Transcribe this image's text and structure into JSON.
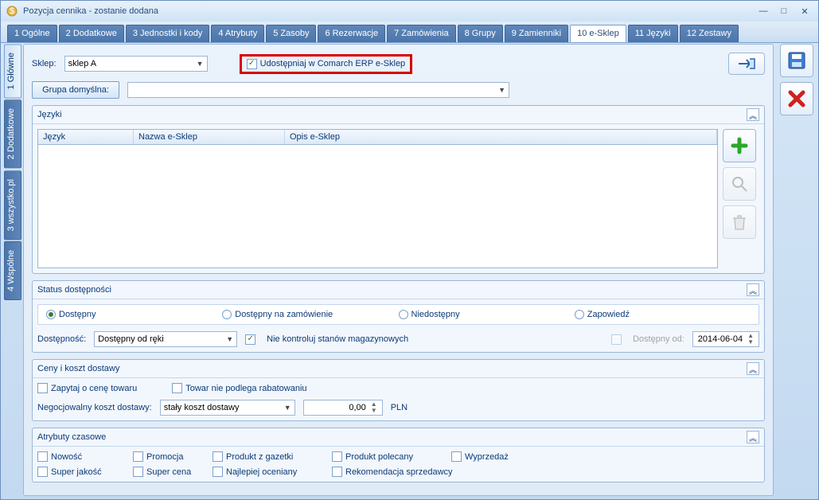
{
  "window": {
    "title": "Pozycja cennika - zostanie dodana"
  },
  "tabs": [
    {
      "label": "1 Ogólne"
    },
    {
      "label": "2 Dodatkowe"
    },
    {
      "label": "3 Jednostki i kody"
    },
    {
      "label": "4 Atrybuty"
    },
    {
      "label": "5 Zasoby"
    },
    {
      "label": "6 Rezerwacje"
    },
    {
      "label": "7 Zamówienia"
    },
    {
      "label": "8 Grupy"
    },
    {
      "label": "9 Zamienniki"
    },
    {
      "label": "10 e-Sklep"
    },
    {
      "label": "11 Języki"
    },
    {
      "label": "12 Zestawy"
    }
  ],
  "vtabs": [
    {
      "label": "1 Główne"
    },
    {
      "label": "2 Dodatkowe"
    },
    {
      "label": "3 wszystko.pl"
    },
    {
      "label": "4 Wspólne"
    }
  ],
  "shop_row": {
    "label": "Sklep:",
    "value": "sklep A",
    "share_label": "Udostępniaj w Comarch ERP e-Sklep"
  },
  "group_row": {
    "button": "Grupa domyślna:",
    "value": ""
  },
  "languages_panel": {
    "title": "Języki",
    "cols": [
      "Język",
      "Nazwa e-Sklep",
      "Opis e-Sklep"
    ]
  },
  "status_panel": {
    "title": "Status dostępności",
    "radios": [
      "Dostępny",
      "Dostępny na zamówienie",
      "Niedostępny",
      "Zapowiedź"
    ],
    "avail_label": "Dostępność:",
    "avail_value": "Dostępny od ręki",
    "nostock_label": "Nie kontroluj stanów magazynowych",
    "from_label": "Dostępny od:",
    "from_value": "2014-06-04"
  },
  "price_panel": {
    "title": "Ceny i koszt dostawy",
    "ask_price": "Zapytaj o cenę towaru",
    "no_discount": "Towar nie podlega rabatowaniu",
    "nego_label": "Negocjowalny koszt dostawy:",
    "nego_value": "stały koszt dostawy",
    "amount": "0,00",
    "currency": "PLN"
  },
  "attr_panel": {
    "title": "Atrybuty czasowe",
    "items": [
      "Nowość",
      "Promocja",
      "Produkt z gazetki",
      "Produkt polecany",
      "Wyprzedaż",
      "Super jakość",
      "Super cena",
      "Najlepiej oceniany",
      "Rekomendacja sprzedawcy"
    ]
  }
}
